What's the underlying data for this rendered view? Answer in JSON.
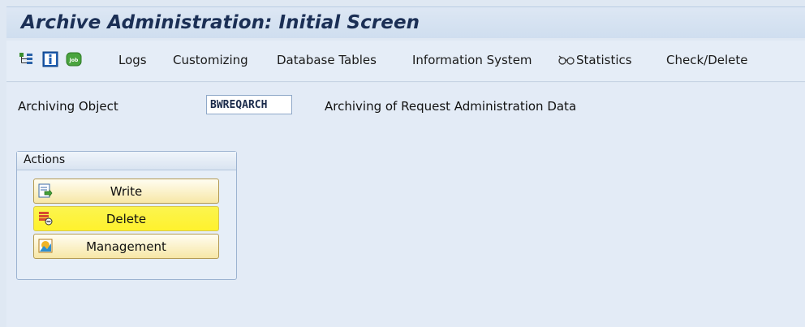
{
  "window": {
    "title": "Archive Administration: Initial Screen"
  },
  "toolbar": {
    "items": [
      {
        "label": "Logs"
      },
      {
        "label": "Customizing"
      },
      {
        "label": "Database Tables"
      },
      {
        "label": "Information System"
      },
      {
        "label": "Statistics"
      },
      {
        "label": "Check/Delete"
      }
    ]
  },
  "form": {
    "archiving_object_label": "Archiving Object",
    "archiving_object_value": "BWREQARCH",
    "archiving_object_description": "Archiving of Request Administration Data"
  },
  "actions": {
    "group_title": "Actions",
    "buttons": [
      {
        "label": "Write"
      },
      {
        "label": "Delete"
      },
      {
        "label": "Management"
      }
    ]
  },
  "colors": {
    "title_text": "#1b2f55",
    "button_gradient_top": "#fffdf1",
    "button_gradient_bottom": "#f7e7a6",
    "highlight": "#fff22d"
  }
}
